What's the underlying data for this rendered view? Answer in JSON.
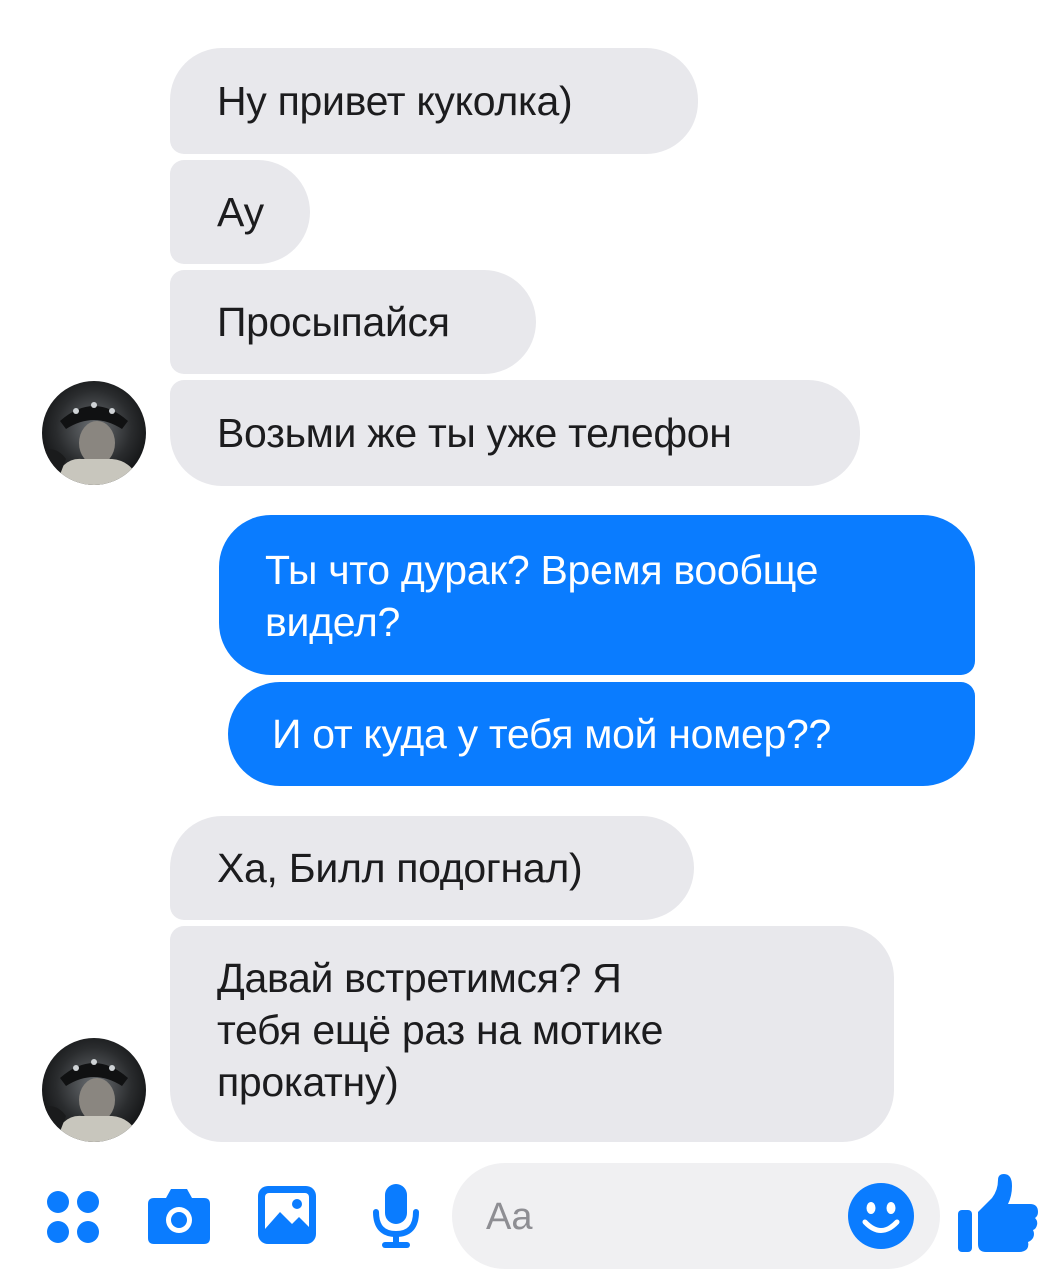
{
  "messages": [
    {
      "side": "incoming",
      "text": "Ну привет куколка)"
    },
    {
      "side": "incoming",
      "text": "Ау"
    },
    {
      "side": "incoming",
      "text": "Просыпайся"
    },
    {
      "side": "incoming",
      "text": "Возьми же ты уже телефон"
    },
    {
      "side": "outgoing",
      "lines": [
        "Ты что дурак? Время вообще",
        "видел?"
      ]
    },
    {
      "side": "outgoing",
      "text": "И от куда у тебя мой номер??"
    },
    {
      "side": "incoming",
      "text": "Ха, Билл подогнал)"
    },
    {
      "side": "incoming",
      "lines": [
        "Давай встретимся? Я",
        "тебя ещё раз на мотике",
        "прокатну)"
      ]
    }
  ],
  "composer": {
    "placeholder": "Aa",
    "icons": [
      "menu-dots-icon",
      "camera-icon",
      "gallery-icon",
      "microphone-icon",
      "emoji-icon",
      "thumbs-up-icon"
    ]
  },
  "colors": {
    "incoming_bubble": "#e8e8ec",
    "outgoing_bubble": "#0a7cff",
    "accent": "#0a7cff"
  }
}
